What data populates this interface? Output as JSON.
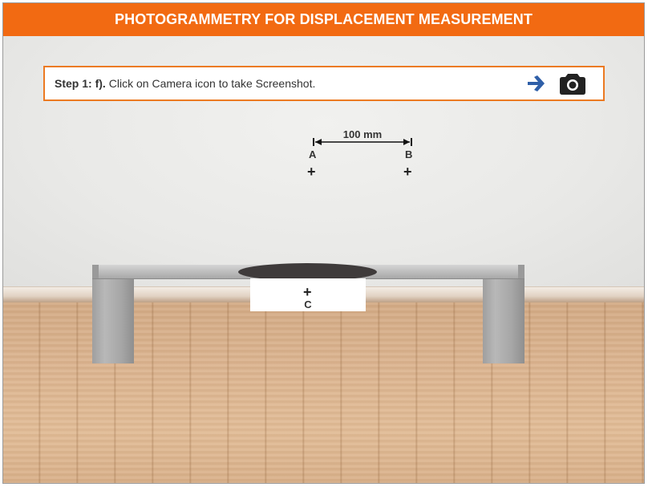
{
  "header": {
    "title": "PHOTOGRAMMETRY FOR DISPLACEMENT MEASUREMENT"
  },
  "instruction": {
    "step": "Step 1: f).",
    "text": "Click on Camera icon to take Screenshot."
  },
  "icons": {
    "arrow": "right-arrow-icon",
    "camera": "camera-icon"
  },
  "measurement": {
    "label": "100 mm"
  },
  "points": {
    "a": {
      "label": "A",
      "marker": "+"
    },
    "b": {
      "label": "B",
      "marker": "+"
    },
    "c": {
      "label": "C",
      "marker": "+"
    }
  },
  "colors": {
    "header": "#f26a12",
    "box_border": "#ec7a22",
    "arrow": "#2f5fa8",
    "camera": "#222222"
  }
}
